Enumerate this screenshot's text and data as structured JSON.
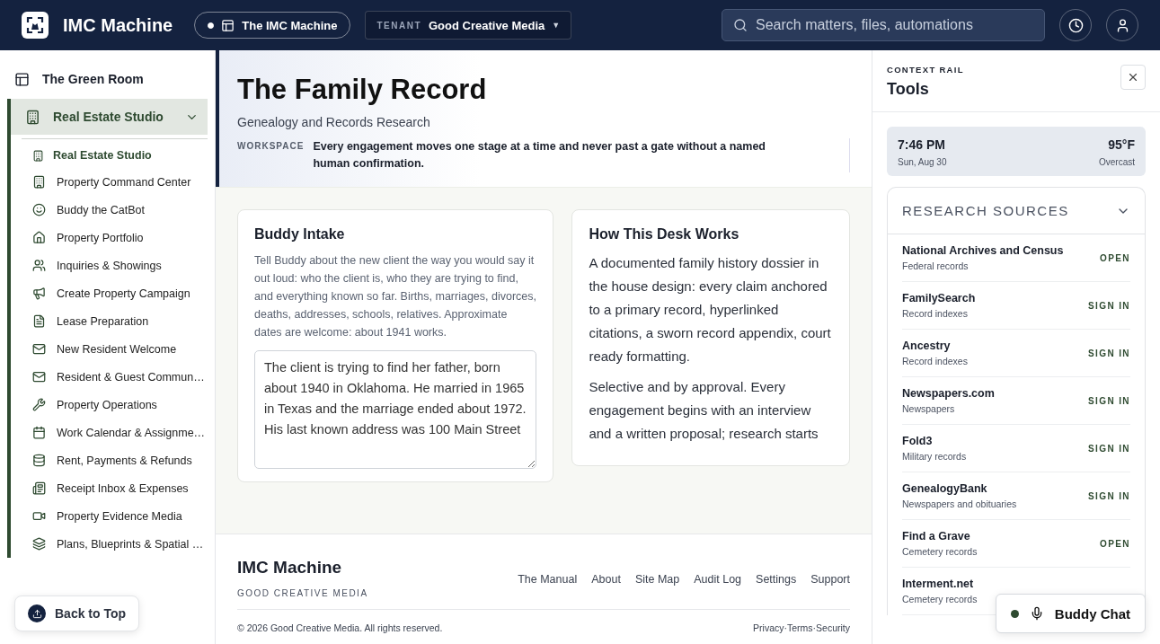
{
  "topbar": {
    "brand": "IMC Machine",
    "workspace_chip": {
      "label": "The IMC Machine",
      "active": true
    },
    "tenant": {
      "label": "TENANT",
      "value": "Good Creative Media",
      "caret": "▼"
    },
    "search": {
      "placeholder": "Search matters, files, automations"
    }
  },
  "sidebar": {
    "top_item": "The Green Room",
    "group": {
      "label": "Real Estate Studio",
      "expanded": true,
      "selected": true,
      "heading": "Real Estate Studio",
      "items": [
        "Property Command Center",
        "Buddy the CatBot",
        "Property Portfolio",
        "Inquiries & Showings",
        "Create Property Campaign",
        "Lease Preparation",
        "New Resident Welcome",
        "Resident & Guest Commun…",
        "Property Operations",
        "Work Calendar & Assignme…",
        "Rent, Payments & Refunds",
        "Receipt Inbox & Expenses",
        "Property Evidence Media",
        "Plans, Blueprints & Spatial …"
      ]
    },
    "back_to_top": "Back to Top"
  },
  "page_header": {
    "title": "The Family Record",
    "subtitle": "Genealogy and Records Research",
    "workspace_label": "WORKSPACE",
    "workspace_text": "Every engagement moves one stage at a time and never past a gate without a named human confirmation."
  },
  "intake_card": {
    "title": "Buddy Intake",
    "help": "Tell Buddy about the new client the way you would say it out loud: who the client is, who they are trying to find, and everything known so far. Births, marriages, divorces, deaths, addresses, schools, relatives. Approximate dates are welcome: about 1941 works.",
    "value": "The client is trying to find her father, born about 1940 in Oklahoma. He married in 1965 in Texas and the marriage ended about 1972. His last known address was 100 Main Street"
  },
  "desk_card": {
    "title": "How This Desk Works",
    "paragraphs": [
      "A documented family history dossier in the house design: every claim anchored to a primary record, hyperlinked citations, a sworn record appendix, court ready formatting.",
      "Selective and by approval. Every engagement begins with an interview and a written proposal; research starts"
    ]
  },
  "footer": {
    "brand": "IMC Machine",
    "tagline": "GOOD CREATIVE MEDIA",
    "links": [
      "The Manual",
      "About",
      "Site Map",
      "Audit Log",
      "Settings",
      "Support"
    ],
    "copyright": "© 2026 Good Creative Media. All rights reserved.",
    "legal": "Privacy·Terms·Security"
  },
  "context_rail": {
    "eyebrow": "CONTEXT RAIL",
    "title": "Tools",
    "clock": {
      "time": "7:46 PM",
      "date": "Sun, Aug 30",
      "temperature": "95°F",
      "condition": "Overcast"
    },
    "sources": {
      "title": "RESEARCH SOURCES",
      "expanded": true,
      "items": [
        {
          "name": "National Archives and Census",
          "description": "Federal records",
          "action": "OPEN"
        },
        {
          "name": "FamilySearch",
          "description": "Record indexes",
          "action": "SIGN IN"
        },
        {
          "name": "Ancestry",
          "description": "Record indexes",
          "action": "SIGN IN"
        },
        {
          "name": "Newspapers.com",
          "description": "Newspapers",
          "action": "SIGN IN"
        },
        {
          "name": "Fold3",
          "description": "Military records",
          "action": "SIGN IN"
        },
        {
          "name": "GenealogyBank",
          "description": "Newspapers and obituaries",
          "action": "SIGN IN"
        },
        {
          "name": "Find a Grave",
          "description": "Cemetery records",
          "action": "OPEN"
        },
        {
          "name": "Interment.net",
          "description": "Cemetery records"
        }
      ]
    }
  },
  "buddy_chat": {
    "label": "Buddy Chat",
    "online": true
  }
}
